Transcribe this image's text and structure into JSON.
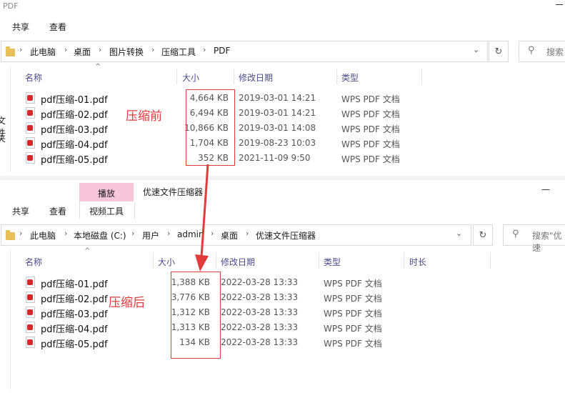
{
  "top": {
    "title": "PDF",
    "tabs": [
      "共享",
      "查看"
    ],
    "breadcrumb": [
      "此电脑",
      "桌面",
      "图片转换",
      "压缩工具",
      "PDF"
    ],
    "search_placeholder": "搜索",
    "side_chars": [
      "文件",
      "夹"
    ],
    "columns": {
      "name": "名称",
      "size": "大小",
      "date": "修改日期",
      "type": "类型"
    },
    "rows": [
      {
        "name": "pdf压缩-01.pdf",
        "size": "4,664 KB",
        "date": "2019-03-01 14:21",
        "type": "WPS PDF 文档"
      },
      {
        "name": "pdf压缩-02.pdf",
        "size": "6,494 KB",
        "date": "2019-03-01 14:21",
        "type": "WPS PDF 文档"
      },
      {
        "name": "pdf压缩-03.pdf",
        "size": "10,866 KB",
        "date": "2019-03-01 14:08",
        "type": "WPS PDF 文档"
      },
      {
        "name": "pdf压缩-04.pdf",
        "size": "1,704 KB",
        "date": "2019-08-23 10:03",
        "type": "WPS PDF 文档"
      },
      {
        "name": "pdf压缩-05.pdf",
        "size": "352 KB",
        "date": "2021-11-09 9:50",
        "type": "WPS PDF 文档"
      }
    ],
    "annotation": "压缩前"
  },
  "bottom": {
    "title": "优速文件压缩器",
    "context_tab": "播放",
    "context_group": "视频工具",
    "tabs": [
      "共享",
      "查看"
    ],
    "breadcrumb": [
      "此电脑",
      "本地磁盘 (C:)",
      "用户",
      "admin",
      "桌面",
      "优速文件压缩器"
    ],
    "search_placeholder": "搜索\"优速",
    "minimize": "—",
    "columns": {
      "name": "名称",
      "size": "大小",
      "date": "修改日期",
      "type": "类型",
      "duration": "时长"
    },
    "rows": [
      {
        "name": "pdf压缩-01.pdf",
        "size": "1,388 KB",
        "date": "2022-03-28 13:33",
        "type": "WPS PDF 文档"
      },
      {
        "name": "pdf压缩-02.pdf",
        "size": "3,776 KB",
        "date": "2022-03-28 13:33",
        "type": "WPS PDF 文档"
      },
      {
        "name": "pdf压缩-03.pdf",
        "size": "1,312 KB",
        "date": "2022-03-28 13:33",
        "type": "WPS PDF 文档"
      },
      {
        "name": "pdf压缩-04.pdf",
        "size": "1,313 KB",
        "date": "2022-03-28 13:33",
        "type": "WPS PDF 文档"
      },
      {
        "name": "pdf压缩-05.pdf",
        "size": "134 KB",
        "date": "2022-03-28 13:33",
        "type": "WPS PDF 文档"
      }
    ],
    "annotation": "压缩后"
  },
  "colors": {
    "annotation_red": "#e23b3b",
    "context_tab_pink": "#f7c6d9",
    "header_text": "#4a4a8a"
  }
}
